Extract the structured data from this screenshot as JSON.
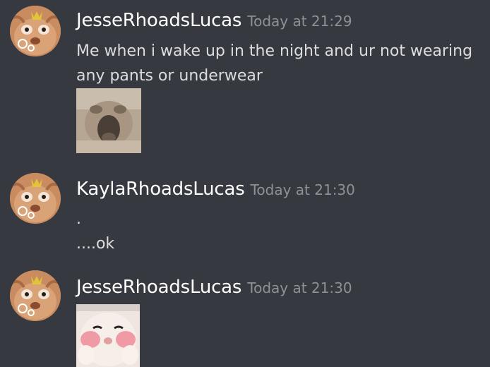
{
  "messages": [
    {
      "username": "JesseRhoadsLucas",
      "timestamp": "Today at 21:29",
      "lines": [
        "Me when i wake up in the night and ur not wearing",
        "any pants or underwear"
      ],
      "attachment": "cat-screaming-image"
    },
    {
      "username": "KaylaRhoadsLucas",
      "timestamp": "Today at 21:30",
      "lines": [
        ".",
        "....ok"
      ]
    },
    {
      "username": "JesseRhoadsLucas",
      "timestamp": "Today at 21:30",
      "attachment": "cat-blushing-image"
    }
  ],
  "colors": {
    "background": "#36393f",
    "username": "#ffffff",
    "timestamp": "#8e9297",
    "message_text": "#dcddde"
  }
}
